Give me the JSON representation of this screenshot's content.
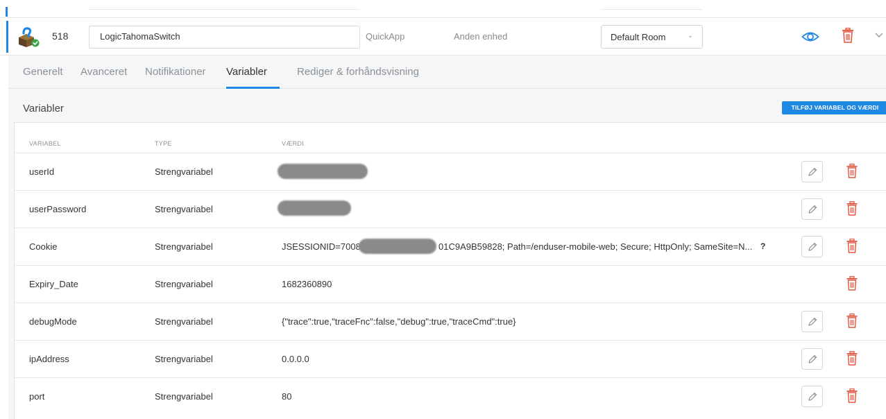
{
  "device": {
    "id": "518",
    "name": "LogicTahomaSwitch",
    "type": "QuickApp",
    "category": "Anden enhed",
    "room": "Default Room"
  },
  "tabs": [
    {
      "label": "Generelt",
      "active": false
    },
    {
      "label": "Avanceret",
      "active": false
    },
    {
      "label": "Notifikationer",
      "active": false
    },
    {
      "label": "Variabler",
      "active": true
    },
    {
      "label": "Rediger & forhåndsvisning",
      "active": false
    }
  ],
  "variables_section": {
    "title": "Variabler",
    "add_button": "TILFØJ VARIABEL OG VÆRDI",
    "headers": {
      "variable": "VARIABEL",
      "type": "TYPE",
      "value": "VÆRDI"
    },
    "rows": [
      {
        "name": "userId",
        "type": "Strengvariabel",
        "value": "",
        "value_redacted": true,
        "editable": true,
        "help": ""
      },
      {
        "name": "userPassword",
        "type": "Strengvariabel",
        "value": "",
        "value_redacted": true,
        "editable": true,
        "help": ""
      },
      {
        "name": "Cookie",
        "type": "Strengvariabel",
        "value_prefix": "JSESSIONID=7008D",
        "value": "01C9A9B59828; Path=/enduser-mobile-web; Secure; HttpOnly; SameSite=N...",
        "value_redacted": true,
        "editable": true,
        "help": "?"
      },
      {
        "name": "Expiry_Date",
        "type": "Strengvariabel",
        "value": "1682360890",
        "value_redacted": false,
        "editable": false,
        "help": ""
      },
      {
        "name": "debugMode",
        "type": "Strengvariabel",
        "value": "{\"trace\":true,\"traceFnc\":false,\"debug\":true,\"traceCmd\":true}",
        "value_redacted": false,
        "editable": true,
        "help": ""
      },
      {
        "name": "ipAddress",
        "type": "Strengvariabel",
        "value": "0.0.0.0",
        "value_redacted": false,
        "editable": true,
        "help": ""
      },
      {
        "name": "port",
        "type": "Strengvariabel",
        "value": "80",
        "value_redacted": false,
        "editable": true,
        "help": ""
      }
    ]
  },
  "colors": {
    "accent": "#1e88e5",
    "delete": "#e0533d",
    "muted_text": "#8d9195",
    "panel_bg": "#f4f6f7"
  },
  "icons": {
    "device": "box-with-gear-icon",
    "status": "check-badge-icon",
    "visibility": "eye-icon",
    "delete": "trash-icon",
    "edit": "pencil-icon",
    "collapse": "chevron-down-icon"
  }
}
